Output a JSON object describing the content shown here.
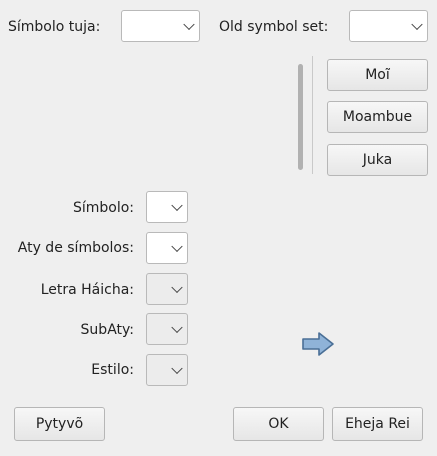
{
  "top": {
    "symbol_set_label": "Símbolo tuja:",
    "old_symbol_set_label": "Old symbol set:"
  },
  "side_buttons": {
    "new": "Moĩ",
    "modify": "Moambue",
    "delete": "Juka"
  },
  "form": {
    "symbol_label": "Símbolo:",
    "symbol_type_label": "Aty de símbolos:",
    "font_label": "Letra Háicha:",
    "subset_label": "SubAty:",
    "style_label": "Estilo:"
  },
  "footer": {
    "help": "Pytyvõ",
    "ok": "OK",
    "cancel": "Eheja Rei"
  },
  "icons": {
    "arrow": "arrow-right-icon"
  },
  "colors": {
    "arrow_fill": "#8fb3d8",
    "arrow_stroke": "#4a6f96"
  }
}
